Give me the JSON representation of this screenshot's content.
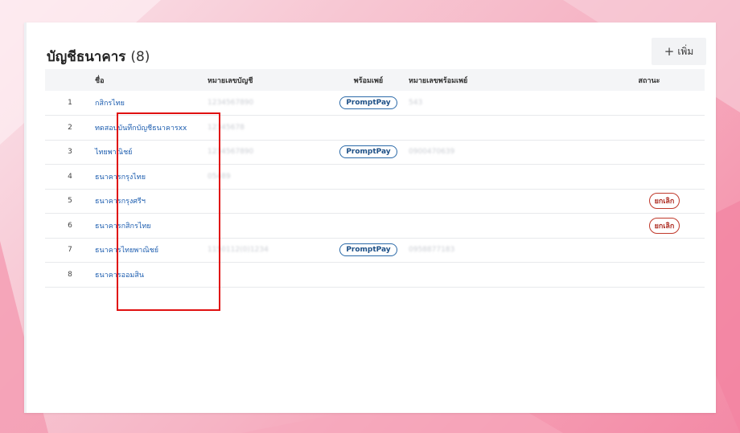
{
  "page": {
    "title": "บัญชีธนาคาร",
    "count": "(8)",
    "add_button_label": "เพิ่ม",
    "add_icon": "plus-icon"
  },
  "table": {
    "headers": {
      "name": "ชื่อ",
      "account_number": "หมายเลขบัญชี",
      "promptpay": "พร้อมเพย์",
      "promptpay_number": "หมายเลขพร้อมเพย์",
      "status": "สถานะ"
    },
    "rows": [
      {
        "no": "1",
        "name": "กสิกรไทย",
        "account": "1234567890",
        "promptpay": "PromptPay",
        "promptpay_number": "543",
        "status": ""
      },
      {
        "no": "2",
        "name": "ทดสอบบันทึกบัญชีธนาคารxx",
        "account": "12345678",
        "promptpay": "",
        "promptpay_number": "",
        "status": ""
      },
      {
        "no": "3",
        "name": "ไทยพาณิชย์",
        "account": "1234567890",
        "promptpay": "PromptPay",
        "promptpay_number": "0900470639",
        "status": ""
      },
      {
        "no": "4",
        "name": "ธนาคารกรุงไทย",
        "account": "05489",
        "promptpay": "",
        "promptpay_number": "",
        "status": ""
      },
      {
        "no": "5",
        "name": "ธนาคารกรุงศรีฯ",
        "account": "",
        "promptpay": "",
        "promptpay_number": "",
        "status": "ยกเลิก"
      },
      {
        "no": "6",
        "name": "ธนาคารกสิกรไทย",
        "account": "",
        "promptpay": "",
        "promptpay_number": "",
        "status": "ยกเลิก"
      },
      {
        "no": "7",
        "name": "ธนาคารไทยพาณิชย์",
        "account": "1150112(0)1234",
        "promptpay": "PromptPay",
        "promptpay_number": "0958877183",
        "status": ""
      },
      {
        "no": "8",
        "name": "ธนาคารออมสิน",
        "account": "",
        "promptpay": "",
        "promptpay_number": "",
        "status": ""
      }
    ]
  },
  "colors": {
    "link": "#1f5fb0",
    "promptpay_border": "#2b6aa8",
    "cancel": "#c0392b",
    "highlight": "#e01010"
  }
}
